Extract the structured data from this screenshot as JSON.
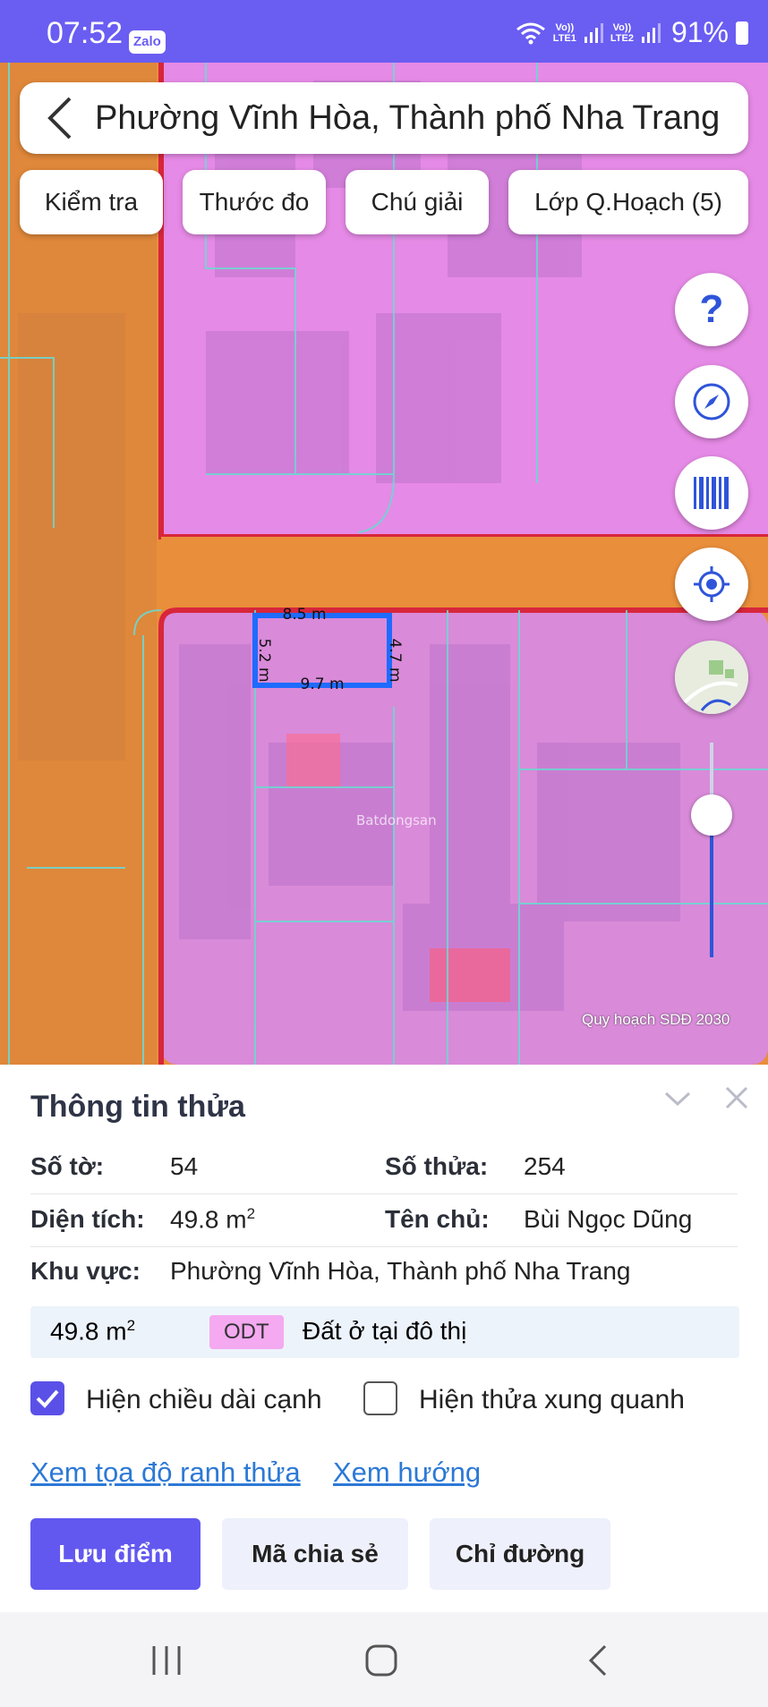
{
  "status_bar": {
    "time": "07:52",
    "app_badge": "Zalo",
    "sim1": "LTE1",
    "sim2": "LTE2",
    "vo1": "Vo))",
    "vo2": "Vo))",
    "battery": "91%"
  },
  "header": {
    "title": "Phường Vĩnh Hòa, Thành phố Nha Trang"
  },
  "toolbar": {
    "check": "Kiểm tra",
    "ruler": "Thước đo",
    "legend": "Chú giải",
    "layer": "Lớp Q.Hoạch (5)"
  },
  "map": {
    "edges": {
      "top": "8.5 m",
      "left": "5.2 m",
      "right": "4.7 m",
      "bottom": "9.7 m"
    },
    "attribution": "Quy hoạch SDĐ 2030",
    "watermark": "Batdongsan",
    "colors": {
      "residential": "#e58ae6",
      "road": "#e98e3a",
      "selected": "#1f6bff",
      "boundary": "#d8263b"
    }
  },
  "panel": {
    "title": "Thông tin thửa",
    "sheet_label": "Số tờ:",
    "sheet_value": "54",
    "parcel_label": "Số thửa:",
    "parcel_value": "254",
    "area_label": "Diện tích:",
    "area_value": "49.8 m",
    "owner_label": "Tên chủ:",
    "owner_value": "Bùi Ngọc Dũng",
    "region_label": "Khu vực:",
    "region_value": "Phường Vĩnh Hòa, Thành phố Nha Trang",
    "landuse": {
      "area": "49.8 m",
      "code": "ODT",
      "desc": "Đất ở tại đô thị"
    },
    "sup": "2",
    "show_edges": {
      "label": "Hiện chiều dài cạnh",
      "checked": true
    },
    "show_neighbors": {
      "label": "Hiện thửa xung quanh",
      "checked": false
    },
    "link_coords": "Xem tọa độ ranh thửa",
    "link_direction": "Xem hướng",
    "btn_save": "Lưu điểm",
    "btn_share": "Mã chia sẻ",
    "btn_route": "Chỉ đường"
  }
}
